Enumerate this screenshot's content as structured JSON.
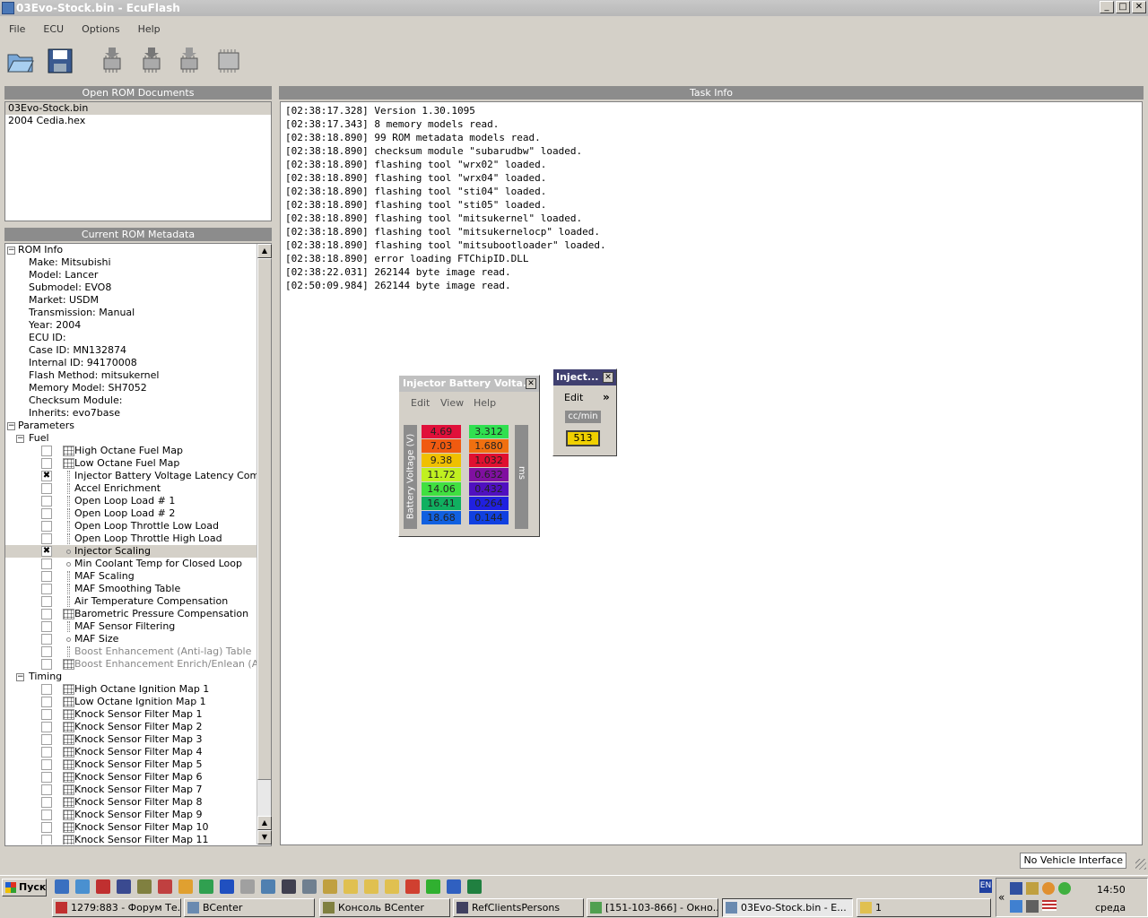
{
  "window": {
    "title": "03Evo-Stock.bin - EcuFlash"
  },
  "menu": [
    "File",
    "ECU",
    "Options",
    "Help"
  ],
  "toolbar": [
    "open-icon",
    "save-icon",
    "read-chip-icon",
    "write-chip-icon",
    "test-write-icon",
    "chip-icon"
  ],
  "open_rom": {
    "header": "Open ROM Documents",
    "items": [
      "03Evo-Stock.bin",
      "2004 Cedia.hex"
    ]
  },
  "metadata": {
    "header": "Current ROM Metadata",
    "rom_info_label": "ROM Info",
    "rom_info": [
      "Make: Mitsubishi",
      "Model: Lancer",
      "Submodel: EVO8",
      "Market: USDM",
      "Transmission: Manual",
      "Year: 2004",
      "ECU ID:",
      "Case ID: MN132874",
      "Internal ID: 94170008",
      "Flash Method: mitsukernel",
      "Memory Model: SH7052",
      "Checksum Module:",
      "Inherits: evo7base"
    ],
    "parameters_label": "Parameters",
    "fuel_label": "Fuel",
    "fuel": [
      {
        "label": "High Octane Fuel Map",
        "icon": "grid",
        "checked": false
      },
      {
        "label": "Low Octane Fuel Map",
        "icon": "grid",
        "checked": false
      },
      {
        "label": "Injector Battery Voltage Latency Comp...",
        "icon": "bar",
        "checked": true
      },
      {
        "label": "Accel Enrichment",
        "icon": "bar",
        "checked": false
      },
      {
        "label": "Open Loop Load # 1",
        "icon": "bar",
        "checked": false
      },
      {
        "label": "Open Loop Load # 2",
        "icon": "bar",
        "checked": false
      },
      {
        "label": "Open Loop Throttle Low Load",
        "icon": "bar",
        "checked": false
      },
      {
        "label": "Open Loop Throttle High Load",
        "icon": "bar",
        "checked": false
      },
      {
        "label": "Injector Scaling",
        "icon": "dot",
        "checked": true,
        "selected": true
      },
      {
        "label": "Min Coolant Temp for Closed Loop",
        "icon": "dot",
        "checked": false
      },
      {
        "label": "MAF Scaling",
        "icon": "bar",
        "checked": false
      },
      {
        "label": "MAF Smoothing Table",
        "icon": "bar",
        "checked": false
      },
      {
        "label": "Air Temperature Compensation",
        "icon": "bar",
        "checked": false
      },
      {
        "label": "Barometric Pressure Compensation",
        "icon": "grid",
        "checked": false
      },
      {
        "label": "MAF Sensor Filtering",
        "icon": "bar",
        "checked": false
      },
      {
        "label": "MAF Size",
        "icon": "dot",
        "checked": false
      },
      {
        "label": "Boost Enhancement (Anti-lag) Table",
        "icon": "bar",
        "checked": false,
        "disabled": true
      },
      {
        "label": "Boost Enhancement Enrich/Enlean (Anti...",
        "icon": "grid",
        "checked": false,
        "disabled": true
      }
    ],
    "timing_label": "Timing",
    "timing": [
      "High Octane Ignition Map 1",
      "Low Octane Ignition Map 1",
      "Knock Sensor Filter Map 1",
      "Knock Sensor Filter Map 2",
      "Knock Sensor Filter Map 3",
      "Knock Sensor Filter Map 4",
      "Knock Sensor Filter Map 5",
      "Knock Sensor Filter Map 6",
      "Knock Sensor Filter Map 7",
      "Knock Sensor Filter Map 8",
      "Knock Sensor Filter Map 9",
      "Knock Sensor Filter Map 10",
      "Knock Sensor Filter Map 11"
    ]
  },
  "task_info": {
    "header": "Task Info",
    "lines": [
      "[02:38:17.328] Version 1.30.1095",
      "[02:38:17.343] 8 memory models read.",
      "[02:38:18.890] 99 ROM metadata models read.",
      "[02:38:18.890] checksum module \"subarudbw\" loaded.",
      "[02:38:18.890] flashing tool \"wrx02\" loaded.",
      "[02:38:18.890] flashing tool \"wrx04\" loaded.",
      "[02:38:18.890] flashing tool \"sti04\" loaded.",
      "[02:38:18.890] flashing tool \"sti05\" loaded.",
      "[02:38:18.890] flashing tool \"mitsukernel\" loaded.",
      "[02:38:18.890] flashing tool \"mitsukernelocp\" loaded.",
      "[02:38:18.890] flashing tool \"mitsubootloader\" loaded.",
      "[02:38:18.890] error loading FTChipID.DLL",
      "[02:38:22.031] 262144 byte image read.",
      "[02:50:09.984] 262144 byte image read."
    ]
  },
  "latency_window": {
    "title": "Injector Battery Volta...",
    "menu": [
      "Edit",
      "View",
      "Help"
    ],
    "axis_label": "Battery Voltage (V)",
    "unit_label": "ms",
    "voltages": [
      "4.69",
      "7.03",
      "9.38",
      "11.72",
      "14.06",
      "16.41",
      "18.68"
    ],
    "latencies": [
      "3.312",
      "1.680",
      "1.032",
      "0.632",
      "0.432",
      "0.264",
      "0.144"
    ],
    "voltage_colors": [
      "#e0103a",
      "#f05a10",
      "#f0c000",
      "#c0f020",
      "#40e040",
      "#10b060",
      "#1060e0"
    ],
    "latency_colors": [
      "#30e050",
      "#f07010",
      "#e01030",
      "#8010a0",
      "#5010c0",
      "#2020e0",
      "#1040e0"
    ]
  },
  "scaling_window": {
    "title": "Inject...",
    "menu": [
      "Edit"
    ],
    "more": "»",
    "unit": "cc/min",
    "value": "513",
    "value_color": "#f0d000"
  },
  "status": {
    "interface": "No Vehicle Interface"
  },
  "taskbar": {
    "start": "Пуск",
    "tasks": [
      {
        "label": "1279:883 - Форум Те..."
      },
      {
        "label": "BCenter"
      },
      {
        "label": "Консоль BCenter"
      },
      {
        "label": "RefClientsPersons"
      },
      {
        "label": "[151-103-866] - Окно..."
      },
      {
        "label": "03Evo-Stock.bin - E...",
        "active": true
      },
      {
        "label": "1"
      }
    ],
    "lang": "EN",
    "clock": "14:50",
    "day": "среда",
    "tray_chevron": "«"
  }
}
